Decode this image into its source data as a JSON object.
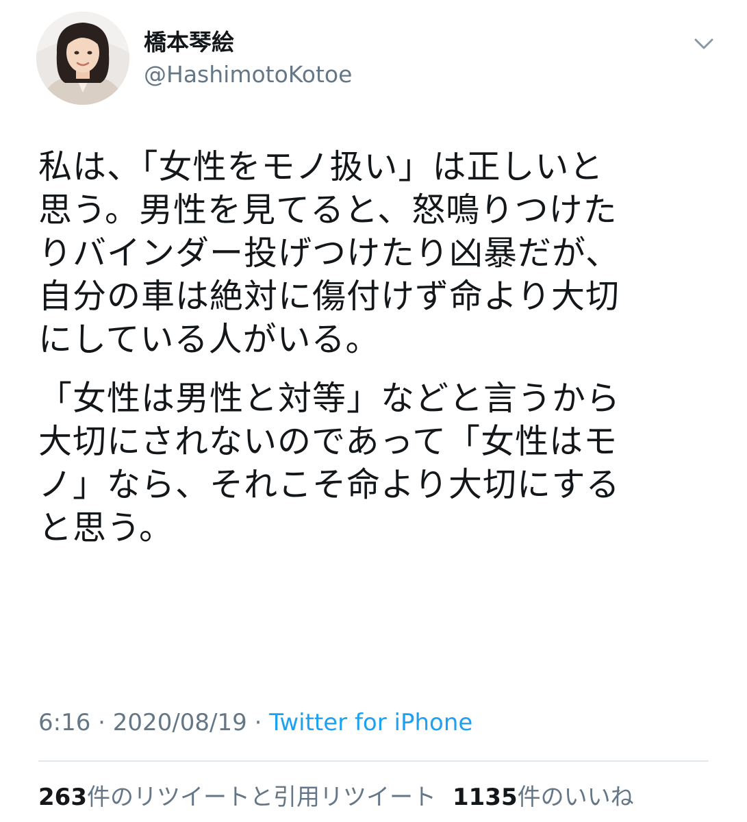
{
  "tweet": {
    "author": {
      "name": "橋本琴絵",
      "handle": "@HashimotoKotoe",
      "avatar_icon": "profile-photo"
    },
    "text_lines": [
      [
        "私は、「女性をモノ扱い」は正しいと",
        "思う。男性を見てると、怒鳴りつけた",
        "りバインダー投げつけたり凶暴だが、",
        "自分の車は絶対に傷付けず命より大切",
        "にしている人がいる。"
      ],
      [
        "「女性は男性と対等」などと言うから",
        "大切にされないのであって「女性はモ",
        "ノ」なら、それこそ命より大切にする",
        "と思う。"
      ]
    ],
    "time": "6:16",
    "date": "2020/08/19",
    "separator": " · ",
    "source": "Twitter for iPhone",
    "retweets": {
      "count": "263",
      "label": "件のリツイートと引用リツイート"
    },
    "likes": {
      "count": "1135",
      "label": "件のいいね"
    },
    "colors": {
      "text": "#14171a",
      "secondary": "#657786",
      "link": "#1da1f2",
      "divider": "#e1e8ed"
    }
  }
}
